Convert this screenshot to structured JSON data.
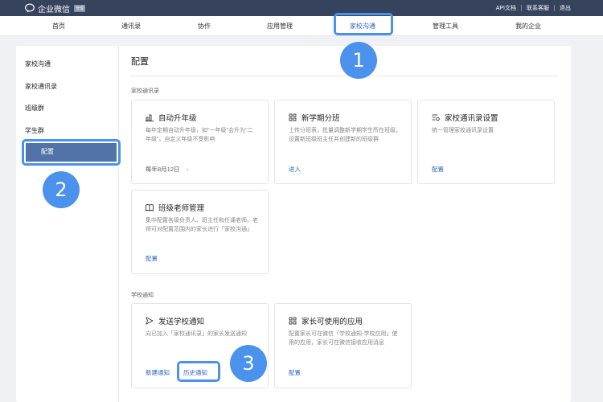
{
  "topbar": {
    "logo_text": "企业微信",
    "logo_badge": "管理",
    "links": [
      "API文档",
      "联系客服",
      "退出"
    ]
  },
  "nav": {
    "items": [
      "首页",
      "通讯录",
      "协作",
      "应用管理",
      "家校沟通",
      "管理工具",
      "我的企业"
    ],
    "active_index": 4
  },
  "sidebar": {
    "items": [
      "家校沟通",
      "家校通讯录",
      "班级群",
      "学生群",
      "配置"
    ],
    "active_index": 4
  },
  "main": {
    "title": "配置",
    "sections": [
      {
        "label": "家校通讯录",
        "cards": [
          {
            "icon": "bar-chart-icon",
            "title": "自动升年级",
            "desc": "每年定期自动升年级，如\"一年级\"会升为\"二年级\"。自定义年级不受影响",
            "date": "每年8月12日",
            "date_arrow": "›"
          },
          {
            "icon": "grid-icon",
            "title": "新学期分班",
            "desc": "上传分班表，批量调整新学期学生所在班级，设置新班级班主任并创建新的班级群",
            "link": "进入"
          },
          {
            "icon": "list-settings-icon",
            "title": "家校通讯录设置",
            "desc": "统一管理家校通讯录设置",
            "link": "配置"
          },
          {
            "icon": "book-icon",
            "title": "班级老师管理",
            "desc": "集中配置各级负责人、班主任和任课老师。老师可对配置范围内的家长进行「家校沟通」",
            "link": "配置"
          }
        ]
      },
      {
        "label": "学校通知",
        "cards": [
          {
            "icon": "send-icon",
            "title": "发送学校通知",
            "desc": "向已加入「家校通讯录」的家长发送通知",
            "links": [
              "新建通知",
              "历史通知"
            ]
          },
          {
            "icon": "apps-icon",
            "title": "家长可使用的应用",
            "desc": "配置家长可在微信「学校通知-学校应用」使用的应用，家长可在微信接收应用消息",
            "link": "配置"
          }
        ]
      }
    ]
  },
  "badges": [
    "1",
    "2",
    "3"
  ],
  "colors": {
    "topbar": "#36435c",
    "accent": "#2b63c0",
    "highlight": "#4b92ec",
    "active_sidebar": "#5273a8"
  }
}
